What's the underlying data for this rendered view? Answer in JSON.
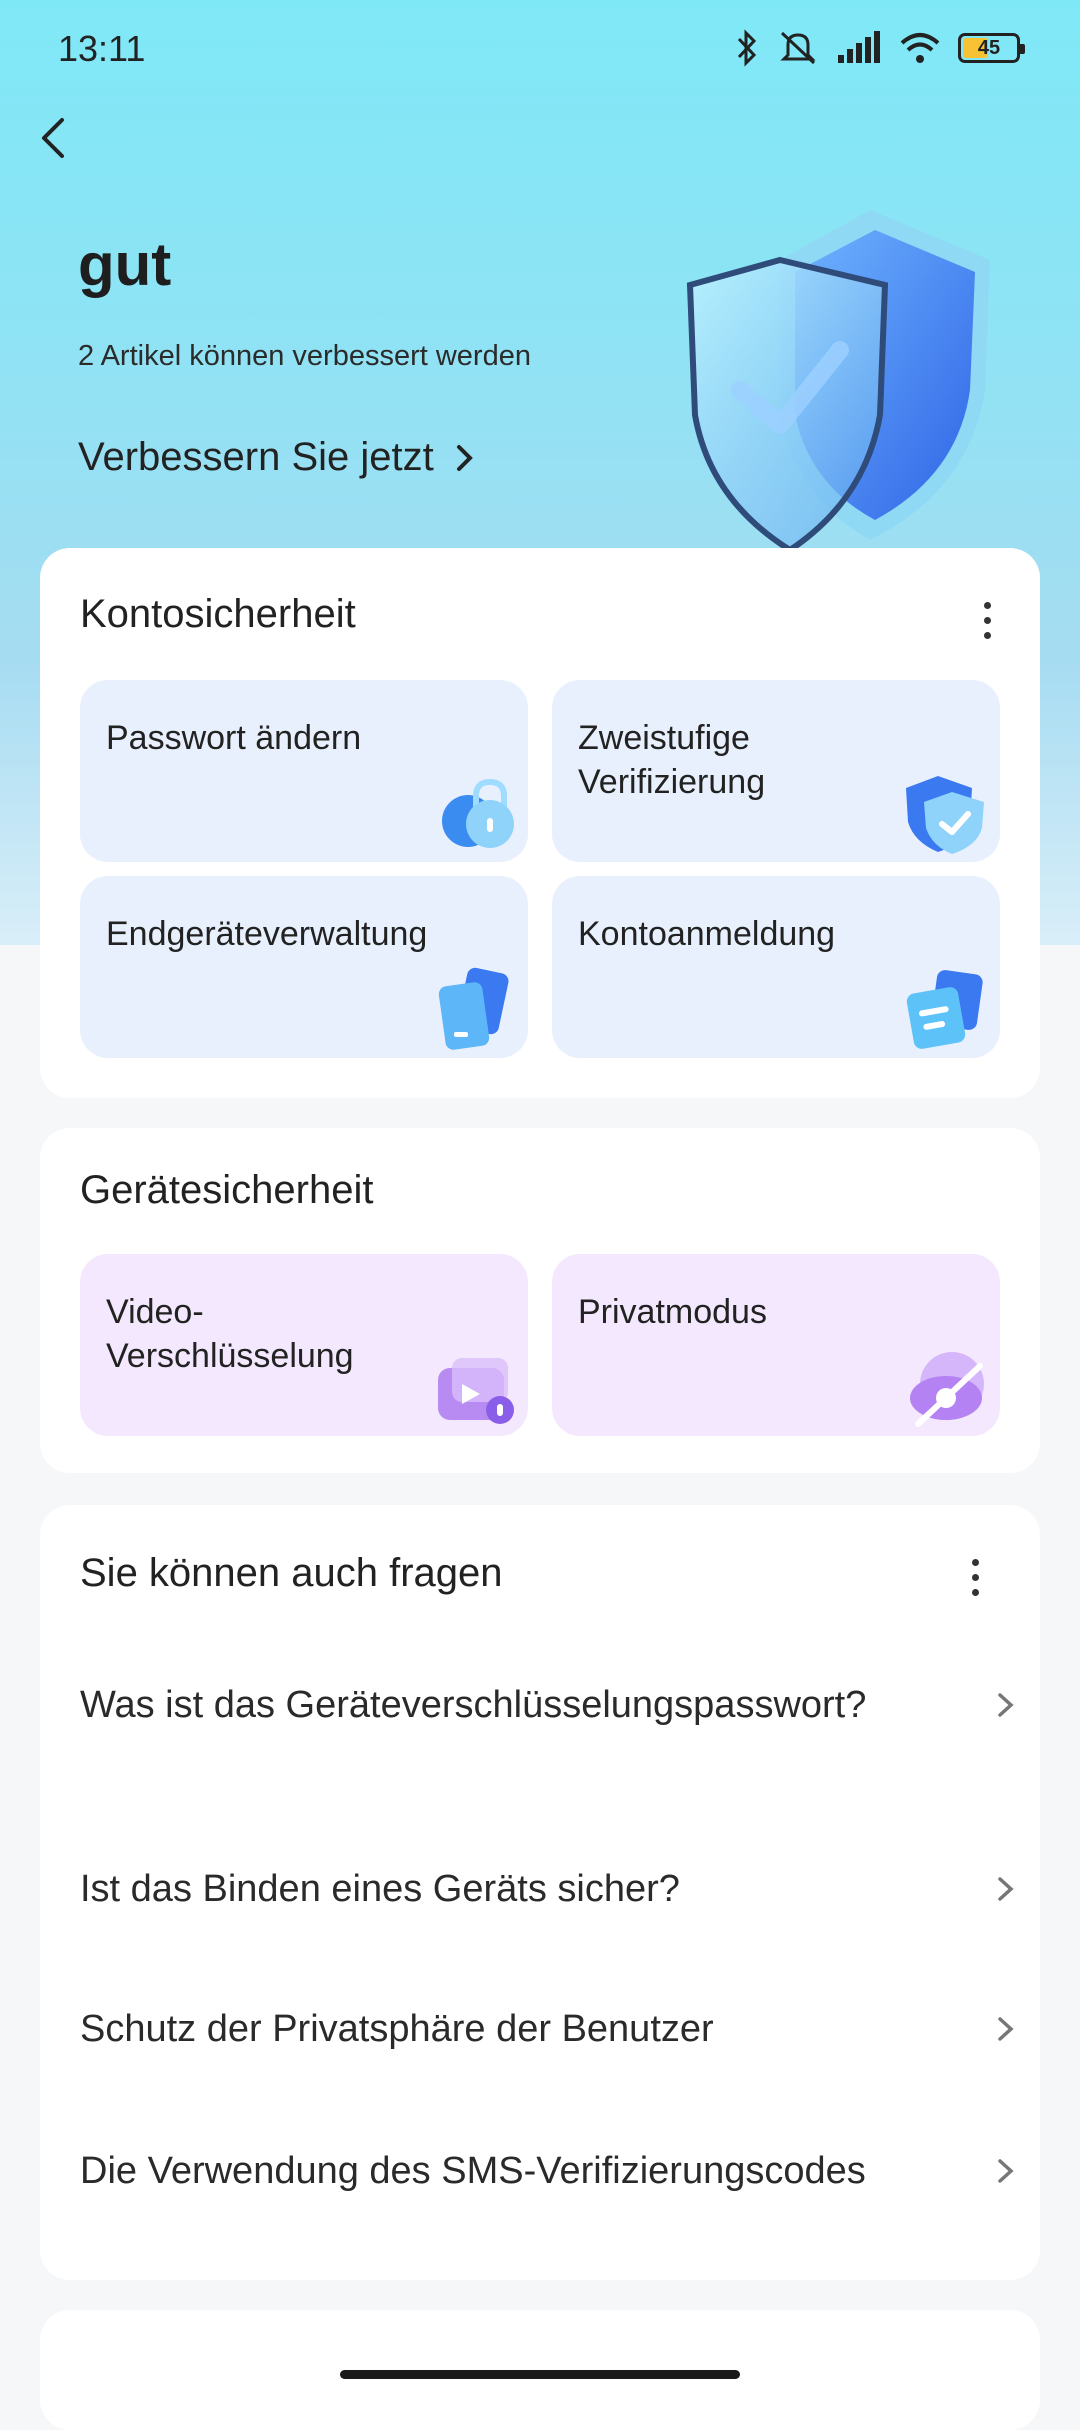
{
  "status": {
    "time": "13:11",
    "battery": "45"
  },
  "hero": {
    "title": "gut",
    "subtitle": "2 Artikel können verbessert werden",
    "improve_label": "Verbessern Sie jetzt"
  },
  "account_security": {
    "title": "Kontosicherheit",
    "tiles": [
      {
        "label": "Passwort ändern",
        "icon": "lock-icon"
      },
      {
        "label": "Zweistufige Verifizierung",
        "icon": "shield-check-icon"
      },
      {
        "label": "Endgeräteverwaltung",
        "icon": "devices-icon"
      },
      {
        "label": "Kontoanmeldung",
        "icon": "login-record-icon"
      }
    ]
  },
  "device_security": {
    "title": "Gerätesicherheit",
    "tiles": [
      {
        "label": "Video-Verschlüsselung",
        "icon": "video-lock-icon"
      },
      {
        "label": "Privatmodus",
        "icon": "eye-off-icon"
      }
    ]
  },
  "faq": {
    "title": "Sie können auch fragen",
    "items": [
      {
        "label": "Was ist das Geräteverschlüsselungspasswort?"
      },
      {
        "label": "Ist das Binden eines Geräts sicher?"
      },
      {
        "label": "Schutz der Privatsphäre der Benutzer"
      },
      {
        "label": "Die Verwendung des SMS-Verifizierungscodes"
      }
    ]
  },
  "colors": {
    "hero_gradient_top": "#7fe8f6",
    "tile_blue": "#e8f0fd",
    "tile_purple": "#f3e8fd",
    "shield_blue": "#3f7ef0"
  }
}
